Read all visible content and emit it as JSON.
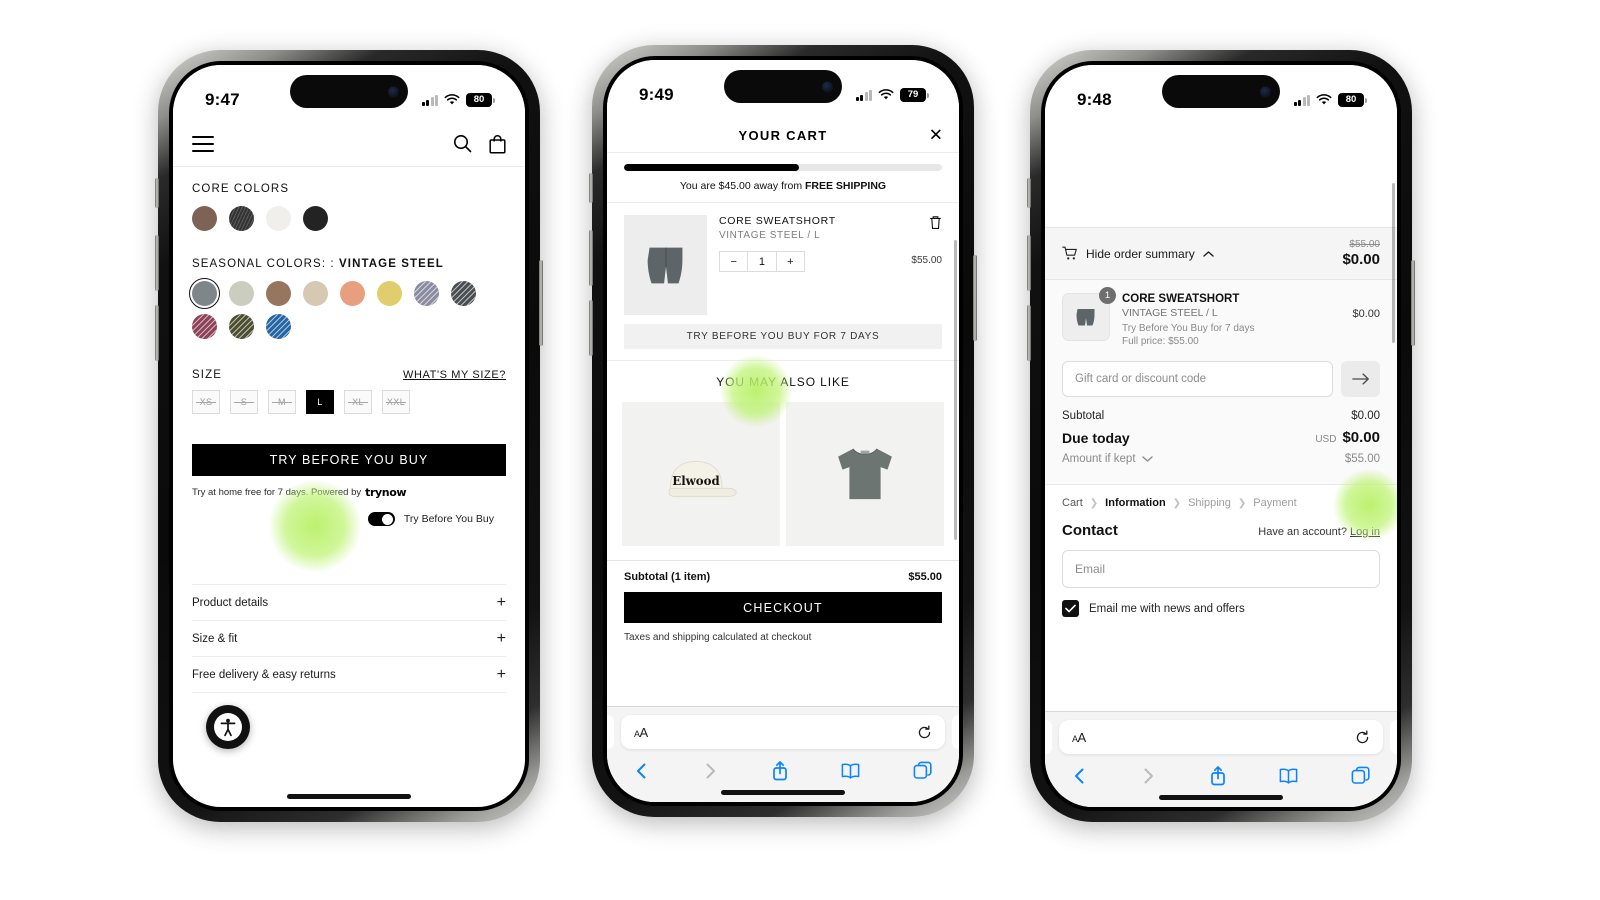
{
  "phones": {
    "pdp": {
      "status": {
        "time": "9:47",
        "battery": "80",
        "wifi_icon": "wifi-icon",
        "signal_icon": "cellular-icon"
      },
      "header": {
        "menu_icon": "hamburger-menu-icon",
        "search_icon": "search-icon",
        "bag_icon": "shopping-bag-icon"
      },
      "core_colors_label": "CORE COLORS",
      "core_colors": [
        {
          "name": "brown",
          "hex": "#7d6355",
          "state": "available"
        },
        {
          "name": "charcoal-texture",
          "hex": "#3a3a3a",
          "state": "textured"
        },
        {
          "name": "off-white",
          "hex": "#f0efec",
          "state": "available"
        },
        {
          "name": "black",
          "hex": "#232323",
          "state": "available"
        }
      ],
      "seasonal_label_prefix": "SEASONAL COLORS: :",
      "seasonal_label_value": "VINTAGE STEEL",
      "seasonal_colors": [
        {
          "name": "vintage-steel",
          "hex": "#7e868a",
          "state": "selected"
        },
        {
          "name": "sage-grey",
          "hex": "#cbcdbf",
          "state": "available"
        },
        {
          "name": "taupe",
          "hex": "#96765f",
          "state": "available"
        },
        {
          "name": "sand",
          "hex": "#d6c8b2",
          "state": "available"
        },
        {
          "name": "salmon",
          "hex": "#e79f7f",
          "state": "available"
        },
        {
          "name": "butter",
          "hex": "#e0cd6d",
          "state": "available"
        },
        {
          "name": "slate-blue",
          "hex": "#8a8da2",
          "state": "sold-out"
        },
        {
          "name": "graphite",
          "hex": "#4a4e52",
          "state": "sold-out"
        },
        {
          "name": "wine",
          "hex": "#8c4356",
          "state": "sold-out"
        },
        {
          "name": "olive",
          "hex": "#4d5030",
          "state": "sold-out"
        },
        {
          "name": "cobalt",
          "hex": "#2566a3",
          "state": "sold-out"
        }
      ],
      "size_label": "SIZE",
      "whats_my_size": "WHAT'S MY SIZE?",
      "sizes": [
        {
          "label": "XS",
          "state": "unavailable"
        },
        {
          "label": "S",
          "state": "unavailable"
        },
        {
          "label": "M",
          "state": "unavailable"
        },
        {
          "label": "L",
          "state": "selected"
        },
        {
          "label": "XL",
          "state": "unavailable"
        },
        {
          "label": "XXL",
          "state": "unavailable"
        }
      ],
      "cta_label": "TRY BEFORE YOU BUY",
      "try_note": "Try at home free for 7 days. Powered by",
      "trynow_brand": "trynow",
      "toggle_label": "Try Before You Buy",
      "toggle_state": "on",
      "accordion": [
        {
          "label": "Product details",
          "icon": "plus-icon"
        },
        {
          "label": "Size & fit",
          "icon": "plus-icon"
        },
        {
          "label": "Free delivery & easy returns",
          "icon": "plus-icon"
        }
      ],
      "a11y_icon": "accessibility-icon"
    },
    "cart": {
      "status": {
        "time": "9:49",
        "battery": "79"
      },
      "title": "YOUR CART",
      "close_icon": "close-icon",
      "progress_percent": 55,
      "shipping_text_prefix": "You are $45.00 away from",
      "shipping_text_bold": "FREE SHIPPING",
      "item": {
        "title": "CORE SWEATSHORT",
        "variant": "VINTAGE STEEL / L",
        "quantity": "1",
        "price": "$55.00",
        "decrement": "−",
        "increment": "+",
        "trash_icon": "trash-icon",
        "tbyb_label": "TRY BEFORE YOU BUY FOR 7 DAYS"
      },
      "also_like_title": "YOU MAY ALSO LIKE",
      "also_like": [
        {
          "name": "elwood-cap",
          "brand_text": "Elwood"
        },
        {
          "name": "grey-cropped-tee",
          "brand_text": ""
        }
      ],
      "subtotal_label": "Subtotal (1 item)",
      "subtotal_value": "$55.00",
      "checkout_label": "CHECKOUT",
      "tax_note": "Taxes and shipping calculated at checkout",
      "safari": {
        "aa_small": "A",
        "aa_large": "A",
        "url": "",
        "reload_icon": "reload-icon",
        "back_icon": "back-icon",
        "forward_icon": "forward-icon",
        "share_icon": "share-icon",
        "bookmarks_icon": "book-icon",
        "tabs_icon": "tabs-icon"
      }
    },
    "checkout": {
      "status": {
        "time": "9:48",
        "battery": "80"
      },
      "summary_toggle": "Hide order summary",
      "cart_icon": "cart-icon",
      "chevron_up_icon": "chevron-up-icon",
      "strike_total": "$55.00",
      "due_total": "$0.00",
      "item": {
        "qty_badge": "1",
        "name": "CORE SWEATSHORT",
        "variant": "VINTAGE STEEL / L",
        "tbyb_note": "Try Before You Buy for 7 days",
        "full_price": "Full price: $55.00",
        "price": "$0.00"
      },
      "discount_placeholder": "Gift card or discount code",
      "discount_submit_icon": "arrow-right-icon",
      "totals": [
        {
          "label": "Subtotal",
          "value": "$0.00",
          "kind": "normal"
        },
        {
          "label": "Due today",
          "value": "$0.00",
          "currency": "USD",
          "kind": "due"
        },
        {
          "label": "Amount if kept",
          "value": "$55.00",
          "kind": "kept",
          "icon": "chevron-down-icon"
        }
      ],
      "breadcrumbs": [
        {
          "label": "Cart",
          "state": "link"
        },
        {
          "label": "Information",
          "state": "current"
        },
        {
          "label": "Shipping",
          "state": "muted"
        },
        {
          "label": "Payment",
          "state": "muted"
        }
      ],
      "contact_heading": "Contact",
      "account_text": "Have an account?",
      "login_link": "Log in",
      "email_placeholder": "Email",
      "newsletter_label": "Email me with news and offers",
      "newsletter_checked": true,
      "safari": {
        "aa_small": "A",
        "aa_large": "A",
        "url": "",
        "reload_icon": "reload-icon"
      }
    }
  }
}
